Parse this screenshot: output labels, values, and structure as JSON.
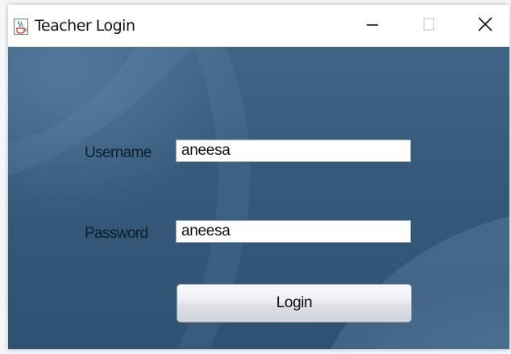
{
  "window": {
    "title": "Teacher Login"
  },
  "form": {
    "username_label": "Username",
    "username_value": "aneesa",
    "password_label": "Password",
    "password_value": "aneesa",
    "login_label": "Login"
  },
  "colors": {
    "background_top": "#3f6585",
    "background_bottom": "#2f5272",
    "label_text": "#0d1d2c",
    "field_background": "#ffffff"
  },
  "icons": {
    "app": "java-cup-icon",
    "minimize": "minimize-icon",
    "maximize": "maximize-icon",
    "close": "close-icon"
  }
}
